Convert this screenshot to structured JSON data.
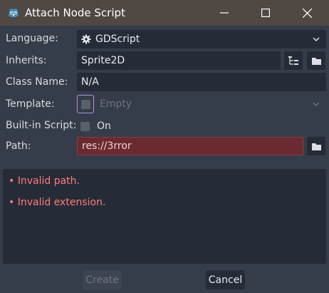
{
  "window": {
    "title": "Attach Node Script",
    "app_icon": "godot-icon",
    "controls": [
      "minimize-icon",
      "maximize-icon",
      "close-icon"
    ]
  },
  "form": {
    "language": {
      "label": "Language:",
      "value": "GDScript",
      "icon": "gear-icon"
    },
    "inherits": {
      "label": "Inherits:",
      "value": "Sprite2D"
    },
    "class_name": {
      "label": "Class Name:",
      "value": "N/A"
    },
    "template": {
      "label": "Template:",
      "value": "Empty",
      "checked": false
    },
    "builtin": {
      "label": "Built-in Script:",
      "value": "On",
      "checked": false
    },
    "path": {
      "label": "Path:",
      "value": "res://3rror"
    }
  },
  "errors": [
    "•  Invalid path.",
    "•  Invalid extension."
  ],
  "buttons": {
    "create": "Create",
    "cancel": "Cancel"
  },
  "colors": {
    "title_bar": "#4f4843",
    "background": "#363d4a",
    "field": "#262c37",
    "error_text": "#ff7a7a",
    "path_error_bg": "#6a2b30",
    "focus_outline": "#b48ee8"
  }
}
